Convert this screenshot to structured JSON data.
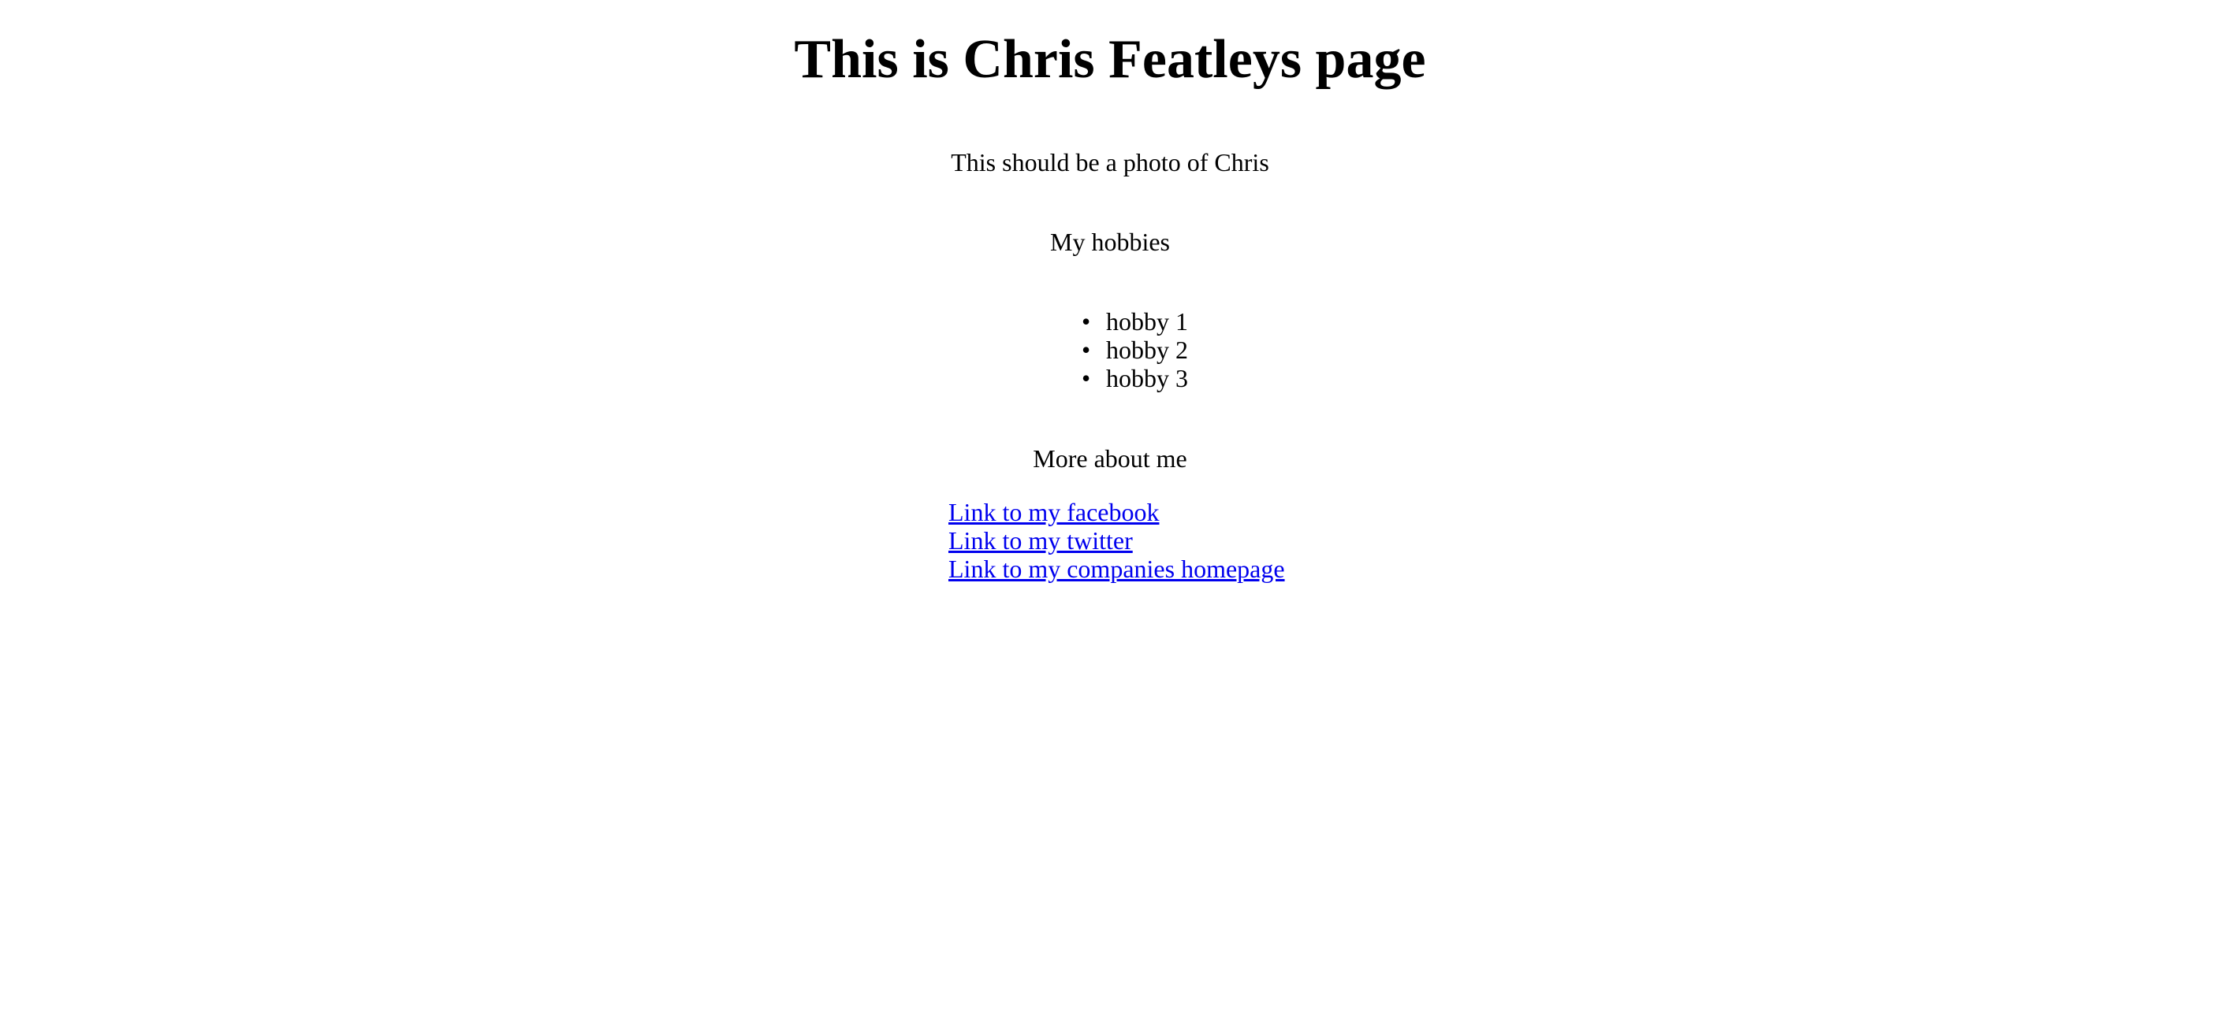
{
  "page": {
    "title": "This is Chris Featleys page",
    "photo_text": "This should be a photo of Chris",
    "hobbies_heading": "My hobbies",
    "hobbies": [
      "hobby 1",
      "hobby 2",
      "hobby 3"
    ],
    "more_heading": "More about me",
    "links": [
      {
        "label": "Link to my facebook"
      },
      {
        "label": "Link to my twitter"
      },
      {
        "label": "Link to my companies homepage"
      }
    ]
  },
  "colors": {
    "text": "#000000",
    "link": "#0000ee",
    "background": "#ffffff"
  }
}
